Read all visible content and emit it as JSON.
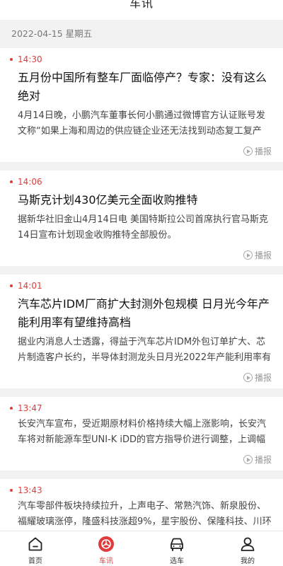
{
  "header": {
    "title": "车讯"
  },
  "date_label": "2022-04-15 星期五",
  "broadcast_label": "播报",
  "news": [
    {
      "time": "14:30",
      "title": "五月份中国所有整车厂面临停产？专家：没有这么绝对",
      "summary": "4月14日晚，小鹏汽车董事长何小鹏通过微博官方认证账号发文称“如果上海和周边的供应链企业还无法找到动态复工复产"
    },
    {
      "time": "14:06",
      "title": "马斯克计划430亿美元全面收购推特",
      "summary": "据新华社旧金山4月14日电 美国特斯拉公司首席执行官马斯克14日宣布计划现金收购推特全部股份。"
    },
    {
      "time": "14:01",
      "title": "汽车芯片IDM厂商扩大封测外包规模 日月光今年产能利用率有望维持高档",
      "summary": "据业内消息人士透露，得益于汽车芯片IDM外包订单扩大、芯片制造客户长约，半导体封测龙头日月光2022年产能利用率有"
    },
    {
      "time": "13:47",
      "title": "",
      "summary": "长安汽车宣布，受近期原材料价格持续大幅上涨影响，长安汽车将对新能源车型UNI-K iDD的官方指导价进行调整，上调幅"
    },
    {
      "time": "13:43",
      "title": "",
      "summary": "汽车零部件板块持续拉升，上声电子、常熟汽饰、新泉股份、福耀玻璃涨停，隆盛科技涨超9%，星宇股份、保隆科技、川环"
    }
  ],
  "tabbar": {
    "home": "首页",
    "news": "车讯",
    "choose": "选车",
    "mine": "我的"
  },
  "colors": {
    "accent": "#e03c3c"
  }
}
